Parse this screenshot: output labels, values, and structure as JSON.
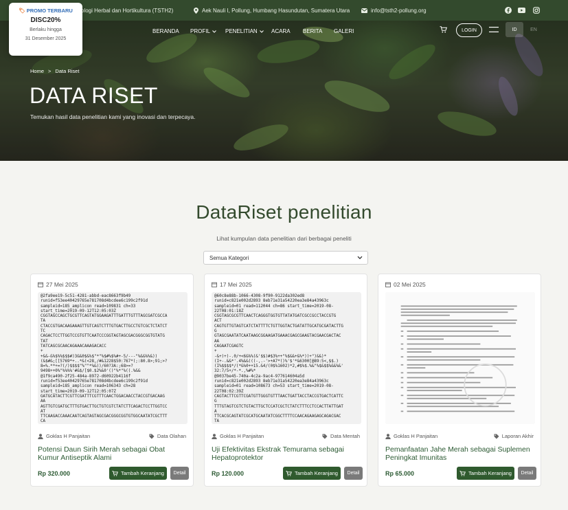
{
  "topbar": {
    "org": "ologi Herbal dan Hortikultura (TSTH2)",
    "address": "Aek Nauli I, Pollung, Humbang Hasundutan, Sumatera Utara",
    "email": "info@tsth2-pollung.org"
  },
  "promo": {
    "header": "PROMO TERBARU",
    "code": "DISC20%",
    "valid_label": "Berlaku hingga",
    "valid_date": "31 Desember 2025"
  },
  "nav": {
    "items": [
      "BERANDA",
      "PROFIL",
      "PENELITIAN",
      "ACARA",
      "BERITA",
      "GALERI"
    ],
    "login": "LOGIN",
    "lang_id": "ID",
    "lang_en": "EN"
  },
  "hero": {
    "crumb_home": "Home",
    "crumb_sep": ">",
    "crumb_current": "Data Riset",
    "title": "DATA RISET",
    "subtitle": "Temukan hasil data penelitian kami yang inovasi dan terpecaya."
  },
  "section": {
    "title": "DataRiset penelitian",
    "subtitle": "Lihat kumpulan data penelitian dari berbagai peneliti",
    "filter_value": "Semua Kategori"
  },
  "cards": [
    {
      "date": "27 Mei 2025",
      "seq": "@2fa9ee19-5c51-4281-abbd-eac8663f9b49\nrunid=f53ee40429765e781708d4bcdee6c199c2f91d\nsampleid=185_amplicon read=109831 ch=33\nstart_time=2019-09-12T12:05:03Z\nCGGTAGCCAGCTGCGTTCAGTATGGAAGATTTGATTTGTTTAGCGATCGCCA\nTA\nCTACCGTGACAAGAAAGTTGTCAGTCTTTGTGACTTGCCTGTCGCTCTATCT\nTC\nCAGACTCCTTGGTCCGTGTTCAATCCCGGTAGTAGCGACGGGCGGTGTATG\nTAT\nTATCAGCGCAACAGAAACAAAGACACC\n+\n+&&-&%$%%$$$#)3&&0$&%$\"*\"%$#%$%#+-5/---\"%&&%%&))\n(&$#&;[[5769*+..*&(<28,/#&1228$50:767*(;:80.8>;91;>?\n8=%.**+=?(/)$$$$\"%\"\"*%&))/60?3A:;68>=?\n9498++0%\"%%%%'#&$/[$0.$2%&0'()\"%*\"%((.%&&\n@1f9ca490-2f25-484a-8972-d60922b4116f\nrunid=f53ee40429765e781708d4bcdee6c199c2f91d\nsampleid=185_amplicon read=106343 ch=28\nstart_time=2019-09-12T12:05:07Z\nGATGCATACTTCGTTCGATTTCGTTTCAACTGGACAACCTACCGTGACAAG\nAA\nAGTTGTCGATGCTTTGTGACTTGCTGTCGTCTATCTTCAGACTCCTTGGTCC\nAT\nTTCAAGACCAAACAATCAGTAGTAGCGACGGGCGGTGTGGCAATATCGCTTT\nCA\nACGAAACACAAAGAAT",
      "author": "Goklas H Panjaitan",
      "category": "Data Olahan",
      "title": "Potensi Daun Sirih Merah sebagai Obat Kumur Antiseptik Alami",
      "price": "Rp 320.000",
      "cart": "Tambah Keranjang",
      "detail": "Detail"
    },
    {
      "date": "17 Mei 2025",
      "seq": "@60c8e88b-1066-4308-9f90-9122da302ed8\nrunid=c821e002d2893 8eb71e31a54220ea3e84a43963c\nsampleid=01 read=112044 ch=86 start_time=2019-08-\n22T08:01:18Z\nCGGTAGCGCGTTCAACTCAGGGTGGTGTTATATGATCGCCGCCTACCGTG\nACT\nCAGTGTTGTAGTCATCTATTTTCTGTTGGTACTGATATTGCATGCGATACTTG\nG\nGTAGCGAATATCAATAAGCGGAAGATGAAACGAGCGAAGTACGAACGACTAC\nAA\nCAGAATCGAGTC\n+\n-&+)+)-.0/+<6&%%(&'$$)#$3%++\"%$&&+&%*))+\")&&)*\n(I+-.&&*'.4%&&(((-,.-'>+A7*()%'$'*&6300[@89:5<,$$.)\n(I%$$$$*/(*&%0++15.&4/(0$%1602)*2,#$%$.%&\"%$&$$%&&%&'\n32:7/5+/*-*.,%#%*\n@9037be45-740a-4c2a-9ac4-977614604a5d\nrunid=c821e002d2893 8eb71e31a54220ea3e84a43963c\nsampleid=01 read=108673 ch=53 start_time=2019-08-\n22T08:02:39Z\nCAGTACTTCGTTCGATGTTGGGTGTTTAACTGATTACCTACCGTGACTCATTC\nG\nTTTGTAGTCGTCTGTACTTGCTCCATCGCTCTATCTTTCCTCCACTTATTGAT\nA\nTTCACGCAGTATCGCATGCAATATCGGCTTTTCCAACAGAAGAGCAGACGAC\nTA\nCCGGCGAGATCAGTC",
      "author": "Goklas H Panjaitan",
      "category": "Data Mentah",
      "title": "Uji Efektivitas Ekstrak Temurama sebagai Hepatoprotektor",
      "price": "Rp 120.000",
      "cart": "Tambah Keranjang",
      "detail": "Detail"
    },
    {
      "date": "02 Mei 2025",
      "author": "Goklas H Panjaitan",
      "category": "Laporan Akhir",
      "title": "Pemanfaatan Jahe Merah sebagai Suplemen Peningkat Imunitas",
      "price": "Rp 65.000",
      "cart": "Tambah Keranjang",
      "detail": "Detail"
    }
  ]
}
